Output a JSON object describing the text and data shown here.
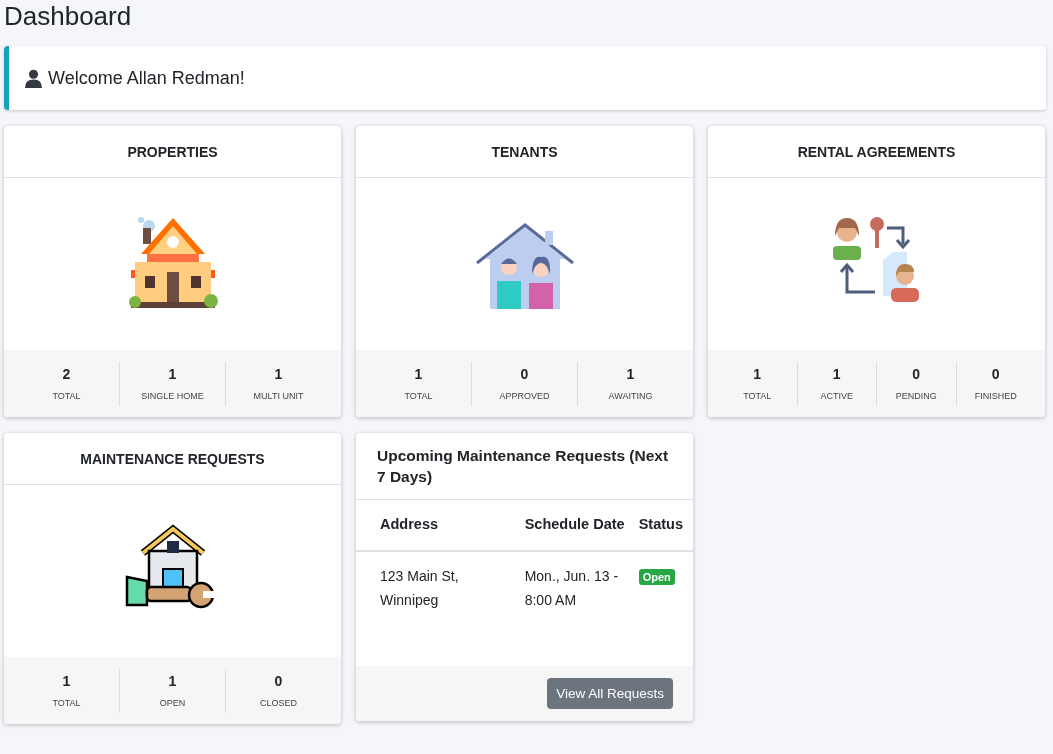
{
  "page_title": "Dashboard",
  "welcome": {
    "text": "Welcome Allan Redman!"
  },
  "stat_cards": [
    {
      "kind": "properties",
      "title": "PROPERTIES",
      "stats": [
        {
          "value": "2",
          "label": "TOTAL"
        },
        {
          "value": "1",
          "label": "SINGLE HOME"
        },
        {
          "value": "1",
          "label": "MULTI UNIT"
        }
      ]
    },
    {
      "kind": "tenants",
      "title": "TENANTS",
      "stats": [
        {
          "value": "1",
          "label": "TOTAL"
        },
        {
          "value": "0",
          "label": "APPROVED"
        },
        {
          "value": "1",
          "label": "AWAITING"
        }
      ]
    },
    {
      "kind": "agreements",
      "title": "RENTAL AGREEMENTS",
      "stats": [
        {
          "value": "1",
          "label": "TOTAL"
        },
        {
          "value": "1",
          "label": "ACTIVE"
        },
        {
          "value": "0",
          "label": "PENDING"
        },
        {
          "value": "0",
          "label": "FINISHED"
        }
      ]
    },
    {
      "kind": "maintenance",
      "title": "MAINTENANCE REQUESTS",
      "stats": [
        {
          "value": "1",
          "label": "TOTAL"
        },
        {
          "value": "1",
          "label": "OPEN"
        },
        {
          "value": "0",
          "label": "CLOSED"
        }
      ]
    }
  ],
  "upcoming": {
    "title": "Upcoming Maintenance Requests (Next 7 Days)",
    "columns": [
      "Address",
      "Schedule Date",
      "Status"
    ],
    "rows": [
      {
        "address": "123 Main St, Winnipeg",
        "date": "Mon., Jun. 13 - 8:00 AM",
        "status": "Open",
        "color": "#28a745"
      }
    ],
    "button": "View All Requests"
  }
}
